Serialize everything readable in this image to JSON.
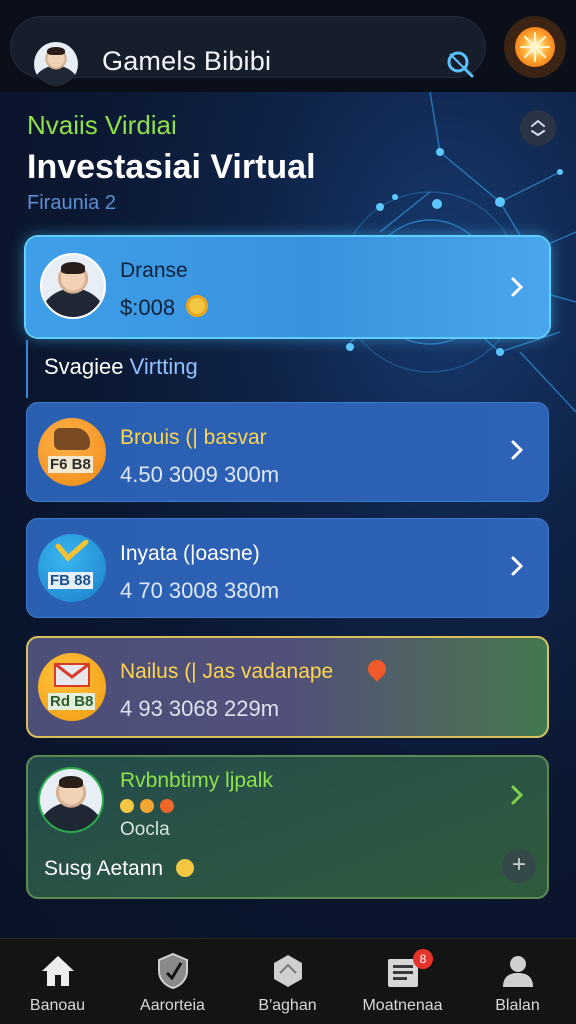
{
  "header": {
    "title": "Gamels Bibibi",
    "search_icon": "search-icon",
    "action_icon": "sun-icon"
  },
  "hero": {
    "eyebrow": "Nvaiis Virdiai",
    "title": "Investasiai Virtual",
    "subtitle": "Firaunia 2"
  },
  "featured_card": {
    "title": "Dranse",
    "value": "$:008",
    "coin_icon": "coin-icon"
  },
  "section": {
    "label_prefix": "Svagiee",
    "label_accent": "Virtting"
  },
  "cards": [
    {
      "title": "Brouis (| basvar",
      "value": "4.50 3009 300m",
      "icon": "chart-bag-icon",
      "tag": "F6 B8"
    },
    {
      "title": "Inyata (|oasne)",
      "value": "4 70 3008 380m",
      "icon": "check-grid-icon",
      "tag": "FB 88"
    },
    {
      "title": "Nailus (| Jas vadanape",
      "value": "4 93 3068 229m",
      "icon": "mail-grid-icon",
      "tag": "Rd B8"
    }
  ],
  "last_card": {
    "title": "Rvbnbtimy ljpalk",
    "sub": "Oocla",
    "footer": "Susg Aetann",
    "plus": "+"
  },
  "nav": [
    {
      "label": "Banoau",
      "icon": "home-icon"
    },
    {
      "label": "Aarorteia",
      "icon": "check-shield-icon"
    },
    {
      "label": "B'aghan",
      "icon": "hexagon-icon"
    },
    {
      "label": "Moatnenaa",
      "icon": "news-icon",
      "badge": "8"
    },
    {
      "label": "Blalan",
      "icon": "profile-icon"
    }
  ],
  "colors": {
    "accent_green": "#8ee14a",
    "featured_blue": "#3e9fe8",
    "card_blue": "#2d62b6",
    "gold_border": "#d8c15a",
    "green_border": "#5d8a52"
  }
}
